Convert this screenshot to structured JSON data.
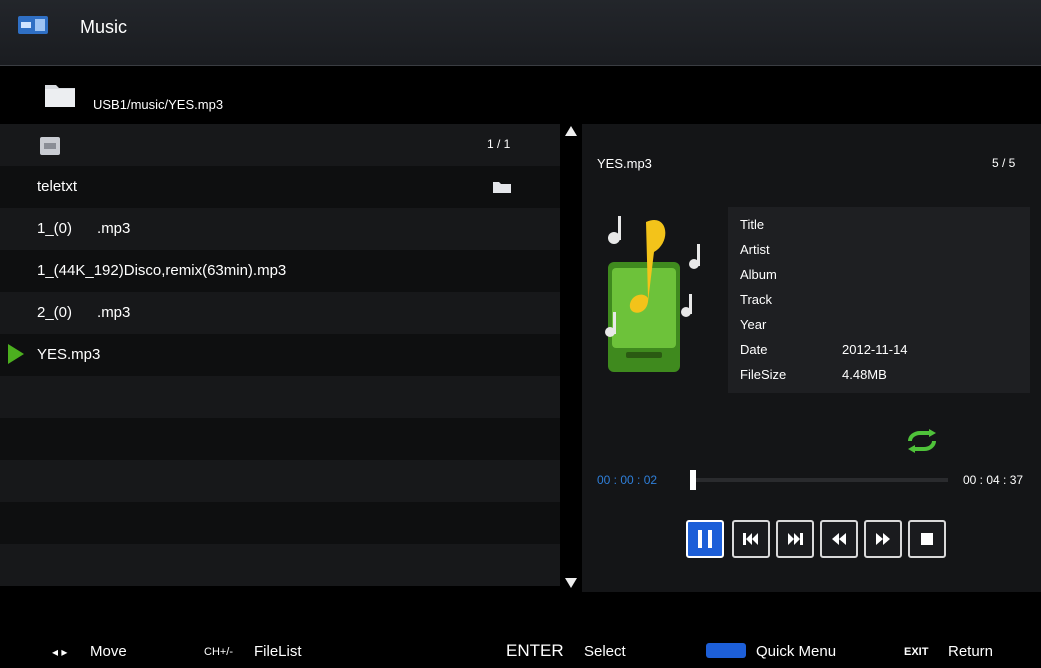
{
  "header": {
    "title": "Music",
    "icon": "usb-icon"
  },
  "path": {
    "text": "USB1/music/YES.mp3",
    "icon": "folder-icon"
  },
  "file_list": {
    "page": "1 / 1",
    "items": [
      {
        "label": "",
        "icon": "up-folder-icon"
      },
      {
        "label": "teletxt",
        "icon": "folder-icon"
      },
      {
        "label": "1_(0)      .mp3"
      },
      {
        "label": "1_(44K_192)Disco,remix(63min).mp3"
      },
      {
        "label": "2_(0)      .mp3"
      },
      {
        "label": "YES.mp3",
        "playing": true
      }
    ]
  },
  "now_playing": {
    "file": "YES.mp3",
    "count": "5 / 5",
    "info": [
      {
        "label": "Title",
        "value": ""
      },
      {
        "label": "Artist",
        "value": ""
      },
      {
        "label": "Album",
        "value": ""
      },
      {
        "label": "Track",
        "value": ""
      },
      {
        "label": "Year",
        "value": ""
      },
      {
        "label": "Date",
        "value": "2012-11-14"
      },
      {
        "label": "FileSize",
        "value": "4.48MB"
      }
    ],
    "elapsed": "00 : 00 : 02",
    "duration": "00 : 04 : 37",
    "progress_fraction": 0.007,
    "repeat_icon": "repeat-icon"
  },
  "controls": [
    "pause-icon",
    "previous-icon",
    "next-icon",
    "rewind-icon",
    "fast-forward-icon",
    "stop-icon"
  ],
  "footer": {
    "move_key": "◂ ▸",
    "move": "Move",
    "filelist_key": "CH+/-",
    "filelist": "FileList",
    "select_key": "ENTER",
    "select": "Select",
    "quickmenu": "Quick Menu",
    "return_key": "EXIT",
    "return": "Return"
  },
  "colors": {
    "accent_blue": "#1d5fd8",
    "play_green": "#4caf1f",
    "time_blue": "#2f7fd9"
  }
}
